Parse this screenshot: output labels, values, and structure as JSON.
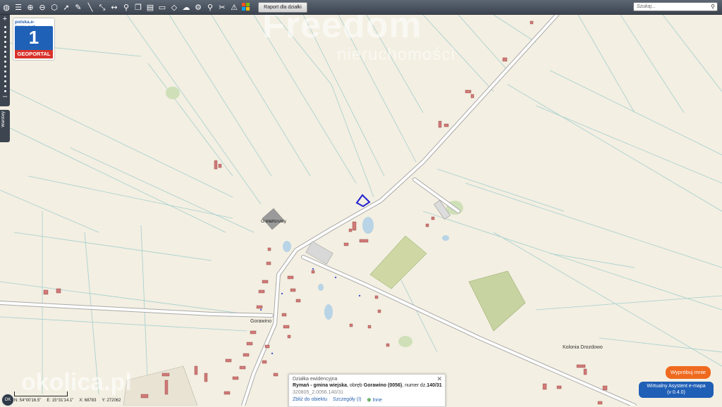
{
  "toolbar": {
    "icons": [
      "globe-icon",
      "layers-icon",
      "zoom-in-icon",
      "zoom-out-icon",
      "zoom-extent-icon",
      "pointer-icon",
      "pencil-icon",
      "measure-line-icon",
      "measure-route-icon",
      "measure-distance-icon",
      "pin-icon",
      "copy-icon",
      "print-icon",
      "car-icon",
      "map-icon",
      "cloud-upload-icon",
      "settings-icon",
      "search-icon",
      "tools-icon",
      "warning-icon",
      "windows-icon"
    ],
    "report_label": "Raport dla działki",
    "search_placeholder": "Szukaj..."
  },
  "badge": {
    "url": "polska.e-mapa.net",
    "number": "1",
    "label": "GEOPORTAL"
  },
  "side": {
    "layers_label": "Warstwy"
  },
  "watermarks": {
    "brand": "Freedom",
    "brand_sub": "nieruchomości",
    "okolica": "okolica.pl"
  },
  "map_labels": {
    "cemetery": "Cmentarz Komunalny",
    "village": "Gorawino",
    "colony": "Kolonia Drozdowo"
  },
  "popup": {
    "header": "Działka ewidencyjna",
    "location_prefix": "Rymań - gmina wiejska",
    "location_mid": ", obręb ",
    "precinct": "Gorawino (0056)",
    "number_prefix": ", numer dz.",
    "number": "140/31",
    "parcel_id": "320805_2.0056.140/31",
    "link_zoom": "Zbliż do obiektu",
    "link_details": "Szczegóły (I)",
    "link_other": "Inne",
    "close": "✕"
  },
  "status": {
    "ok": "OK",
    "lat": "N: 54°00'16.5\"",
    "lon": "E: 15°31'14.1\"",
    "x": "X: 68783",
    "y": "Y: 272062"
  },
  "assistant": {
    "try_label": "Wypróbuj mnie",
    "title": "Wirtualny Asystent e-mapa",
    "version": "(v 0.4.0)"
  },
  "colors": {
    "background": "#f3efe2",
    "parcel_line": "#9fc9c9",
    "road": "#ffffff",
    "road_edge": "#a9a9a9",
    "building": "#d07a78",
    "selected_parcel": "#2020d0",
    "forest": "#c8d3a2",
    "water": "#b8d4e6"
  }
}
